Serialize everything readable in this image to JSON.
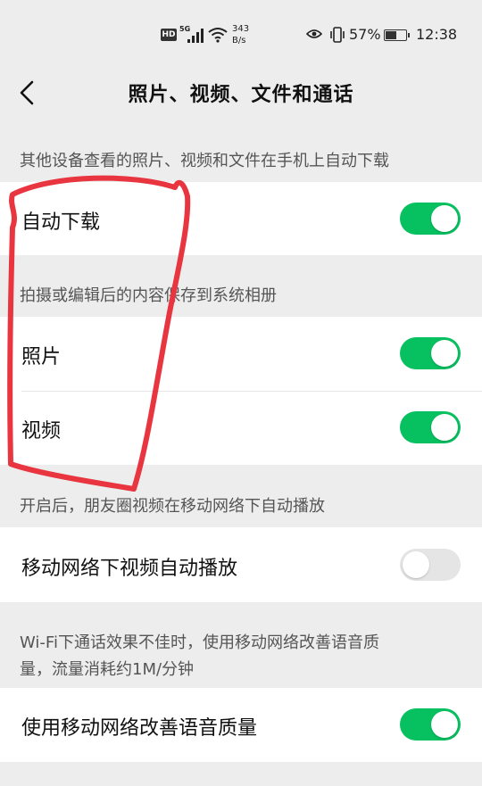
{
  "status_bar": {
    "hd_badge": "HD",
    "network_type": "5G",
    "net_speed_value": "343",
    "net_speed_unit": "B/s",
    "battery_percent": "57%",
    "battery_level": 0.57,
    "time": "12:38"
  },
  "navbar": {
    "title": "照片、视频、文件和通话"
  },
  "sections": [
    {
      "caption": "其他设备查看的照片、视频和文件在手机上自动下载",
      "items": [
        {
          "label": "自动下载",
          "enabled": true
        }
      ]
    },
    {
      "caption": "拍摄或编辑后的内容保存到系统相册",
      "items": [
        {
          "label": "照片",
          "enabled": true
        },
        {
          "label": "视频",
          "enabled": true
        }
      ]
    },
    {
      "caption": "开启后，朋友圈视频在移动网络下自动播放",
      "items": [
        {
          "label": "移动网络下视频自动播放",
          "enabled": false
        }
      ]
    },
    {
      "caption_line1": "Wi-Fi下通话效果不佳时，使用移动网络改善语音质",
      "caption_line2": "量，流量消耗约1M/分钟",
      "items": [
        {
          "label": "使用移动网络改善语音质量",
          "enabled": true
        }
      ]
    }
  ],
  "colors": {
    "toggle_on": "#07c160",
    "toggle_off": "#e5e5e5",
    "annotation": "#e8353f",
    "background": "#ededed"
  }
}
